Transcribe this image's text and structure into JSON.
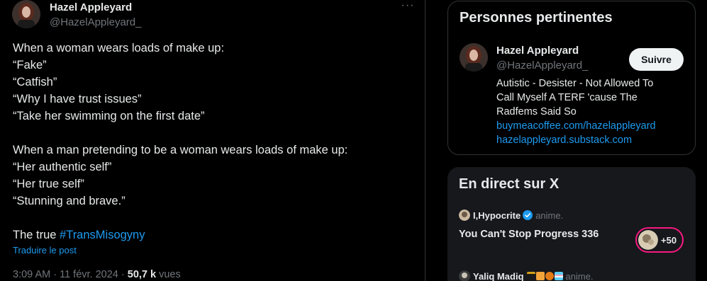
{
  "tweet": {
    "author_name": "Hazel Appleyard",
    "author_handle": "@HazelAppleyard_",
    "more_icon": "more-horizontal-icon",
    "lines": [
      "When a woman wears loads of make up:",
      "“Fake”",
      "“Catfish”",
      "“Why I have trust issues”",
      "“Take her swimming on the first date”",
      "When a man pretending to be a woman wears loads of make up:",
      "“Her authentic self”",
      "“Her true self”",
      "“Stunning and brave.”"
    ],
    "last_line_prefix": "The true ",
    "hashtag": "#TransMisogyny",
    "translate_label": "Traduire le post",
    "time": "3:09 AM",
    "sep1": " · ",
    "date": "11 févr. 2024",
    "sep2": " · ",
    "views_count": "50,7 k",
    "views_label": " vues",
    "colors": {
      "link": "#1d9bf0",
      "text": "#e7e9ea",
      "muted": "#71767b"
    }
  },
  "relevant": {
    "title": "Personnes pertinentes",
    "name": "Hazel Appleyard",
    "handle": "@HazelAppleyard_",
    "follow_label": "Suivre",
    "bio_lines": [
      "Autistic - Desister - Not Allowed To",
      "Call Myself A TERF 'cause The",
      "Radfems Said So"
    ],
    "links": [
      "buymeacoffee.com/hazelappleyard",
      "hazelappleyard.substack.com"
    ]
  },
  "live": {
    "title": "En direct sur X",
    "host1": {
      "name": "I,Hypocrite",
      "activity": "anime.",
      "verified_icon": "verified-badge-icon"
    },
    "space_title": "You Can't Stop Progress 336",
    "listeners": "+50",
    "host2": {
      "name": "Yaliq Madiq",
      "activity": "anime."
    },
    "accent": "#f91880"
  }
}
